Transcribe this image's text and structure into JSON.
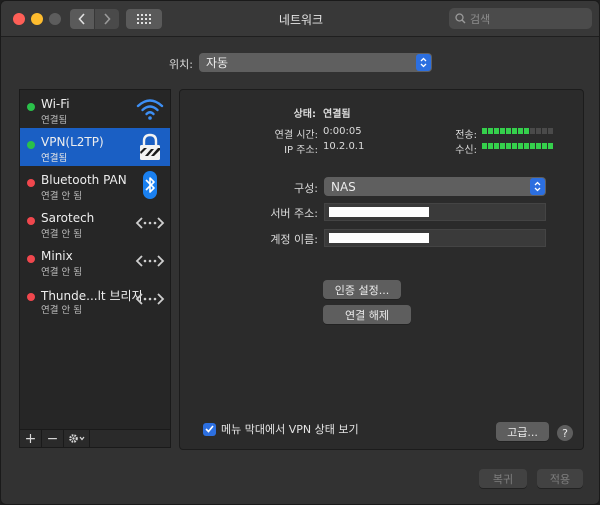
{
  "window": {
    "title": "네트워크"
  },
  "search": {
    "placeholder": "검색"
  },
  "location": {
    "label": "위치:",
    "value": "자동"
  },
  "services": [
    {
      "name": "Wi-Fi",
      "status": "연결됨",
      "dot": "green",
      "icon": "wifi-icon"
    },
    {
      "name": "VPN(L2TP)",
      "status": "연결됨",
      "dot": "green",
      "icon": "vpn-lock-icon"
    },
    {
      "name": "Bluetooth PAN",
      "status": "연결 안 됨",
      "dot": "red",
      "icon": "bluetooth-icon"
    },
    {
      "name": "Sarotech",
      "status": "연결 안 됨",
      "dot": "red",
      "icon": "ethernet-arrows-icon"
    },
    {
      "name": "Minix",
      "status": "연결 안 됨",
      "dot": "red",
      "icon": "ethernet-arrows-icon"
    },
    {
      "name": "Thunde...lt 브리지",
      "status": "연결 안 됨",
      "dot": "red",
      "icon": "ethernet-arrows-icon"
    }
  ],
  "sidebar_footer": {
    "add": "+",
    "remove": "−"
  },
  "detail": {
    "status_label": "상태:",
    "status_value": "연결됨",
    "connect_time_label": "연결 시간:",
    "connect_time_value": "0:00:05",
    "ip_label": "IP 주소:",
    "ip_value": "10.2.0.1",
    "send_label": "전송:",
    "receive_label": "수신:",
    "send_level": 0.67,
    "receive_level": 1.0,
    "config_label": "구성:",
    "config_value": "NAS",
    "server_label": "서버 주소:",
    "account_label": "계정 이름:",
    "auth_button": "인증 설정...",
    "disconnect_button": "연결 해제",
    "show_vpn_label": "메뉴 막대에서 VPN 상태 보기",
    "show_vpn_checked": true,
    "advanced_button": "고급...",
    "help": "?"
  },
  "footer": {
    "revert": "복귀",
    "apply": "적용"
  },
  "colors": {
    "accent": "#2c6fe0",
    "selection": "#1a5fc4",
    "connected": "#2ac14a",
    "disconnected": "#f0474d",
    "meter_on": "#35d04c"
  }
}
